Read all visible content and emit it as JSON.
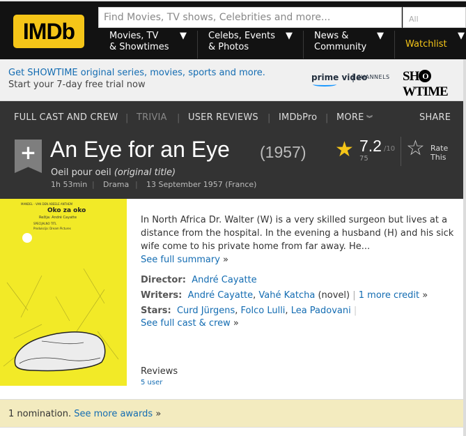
{
  "header": {
    "logo_text": "IMDb",
    "search_placeholder": "Find Movies, TV shows, Celebrities and more...",
    "search_category": "All",
    "nav": [
      {
        "line1": "Movies, TV",
        "line2": "& Showtimes"
      },
      {
        "line1": "Celebs, Events",
        "line2": "& Photos"
      },
      {
        "line1": "News &",
        "line2": "Community"
      }
    ],
    "watchlist": "Watchlist"
  },
  "promo": {
    "line1": "Get SHOWTIME original series, movies, sports and more.",
    "line2": "Start your 7-day free trial now",
    "prime": "prime video",
    "channels": "CHANNELS",
    "showtime_pre": "SH",
    "showtime_o": "O",
    "showtime_post": "WTIME"
  },
  "subnav": {
    "items": [
      "FULL CAST AND CREW",
      "TRIVIA",
      "USER REVIEWS",
      "IMDbPro",
      "MORE"
    ],
    "share": "SHARE",
    "separator": "|"
  },
  "movie": {
    "add_icon": "+",
    "title": "An Eye for an Eye",
    "year": "(1957)",
    "original_title": "Oeil pour oeil",
    "original_label": "(original title)",
    "runtime": "1h 53min",
    "genre": "Drama",
    "release": "13 September 1957 (France)",
    "rating": "7.2",
    "rating_max": "/10",
    "votes": "75",
    "rate_line1": "Rate",
    "rate_line2": "This"
  },
  "poster": {
    "header_small": "MANDEL - VAN DEN ABEELE ANTHEM",
    "title": "Oko za oko",
    "director": "Režija: André Cayatte",
    "line3": "SPECIJALNO TITL",
    "line4": "Produkcija: Dream Pictures"
  },
  "summary": {
    "text": "In North Africa Dr. Walter (W) is a very skilled surgeon but lives at a distance from the hospital. In the evening a husband (H) and his sick wife come to his private home from far away. He...",
    "see_full": "See full summary",
    "arrow": "»"
  },
  "credits": {
    "director_label": "Director:",
    "director": "André Cayatte",
    "writers_label": "Writers:",
    "writer1": "André Cayatte",
    "writer2": "Vahé Katcha",
    "writer2_note": "(novel)",
    "more_credit": "1 more credit",
    "stars_label": "Stars:",
    "star1": "Curd Jürgens",
    "star2": "Folco Lulli",
    "star3": "Lea Padovani",
    "see_cast": "See full cast & crew"
  },
  "reviews": {
    "heading": "Reviews",
    "count": "5 user"
  },
  "awards": {
    "text": "1 nomination.",
    "link": "See more awards"
  }
}
